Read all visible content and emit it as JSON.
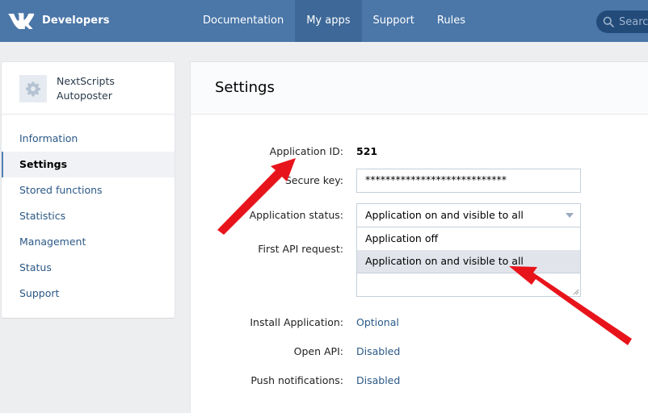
{
  "header": {
    "brand": "Developers",
    "nav": [
      {
        "label": "Documentation"
      },
      {
        "label": "My apps"
      },
      {
        "label": "Support"
      },
      {
        "label": "Rules"
      }
    ],
    "search_placeholder": "Search"
  },
  "sidebar": {
    "app_name_line1": "NextScripts",
    "app_name_line2": "Autoposter",
    "items": [
      {
        "label": "Information"
      },
      {
        "label": "Settings"
      },
      {
        "label": "Stored functions"
      },
      {
        "label": "Statistics"
      },
      {
        "label": "Management"
      },
      {
        "label": "Status"
      },
      {
        "label": "Support"
      }
    ]
  },
  "main": {
    "title": "Settings",
    "app_id_label": "Application ID:",
    "app_id_value": "521",
    "secure_key_label": "Secure key:",
    "secure_key_value": "****************************",
    "status_label": "Application status:",
    "status_value": "Application on and visible to all",
    "status_options": [
      {
        "label": "Application off"
      },
      {
        "label": "Application on and visible to all"
      }
    ],
    "first_api_label": "First API request:",
    "install_label": "Install Application:",
    "install_value": "Optional",
    "open_api_label": "Open API:",
    "open_api_value": "Disabled",
    "push_label": "Push notifications:",
    "push_value": "Disabled"
  },
  "colors": {
    "brand_blue": "#4a76a8",
    "link": "#2a5885",
    "annotation_arrow": "#e8141b"
  }
}
